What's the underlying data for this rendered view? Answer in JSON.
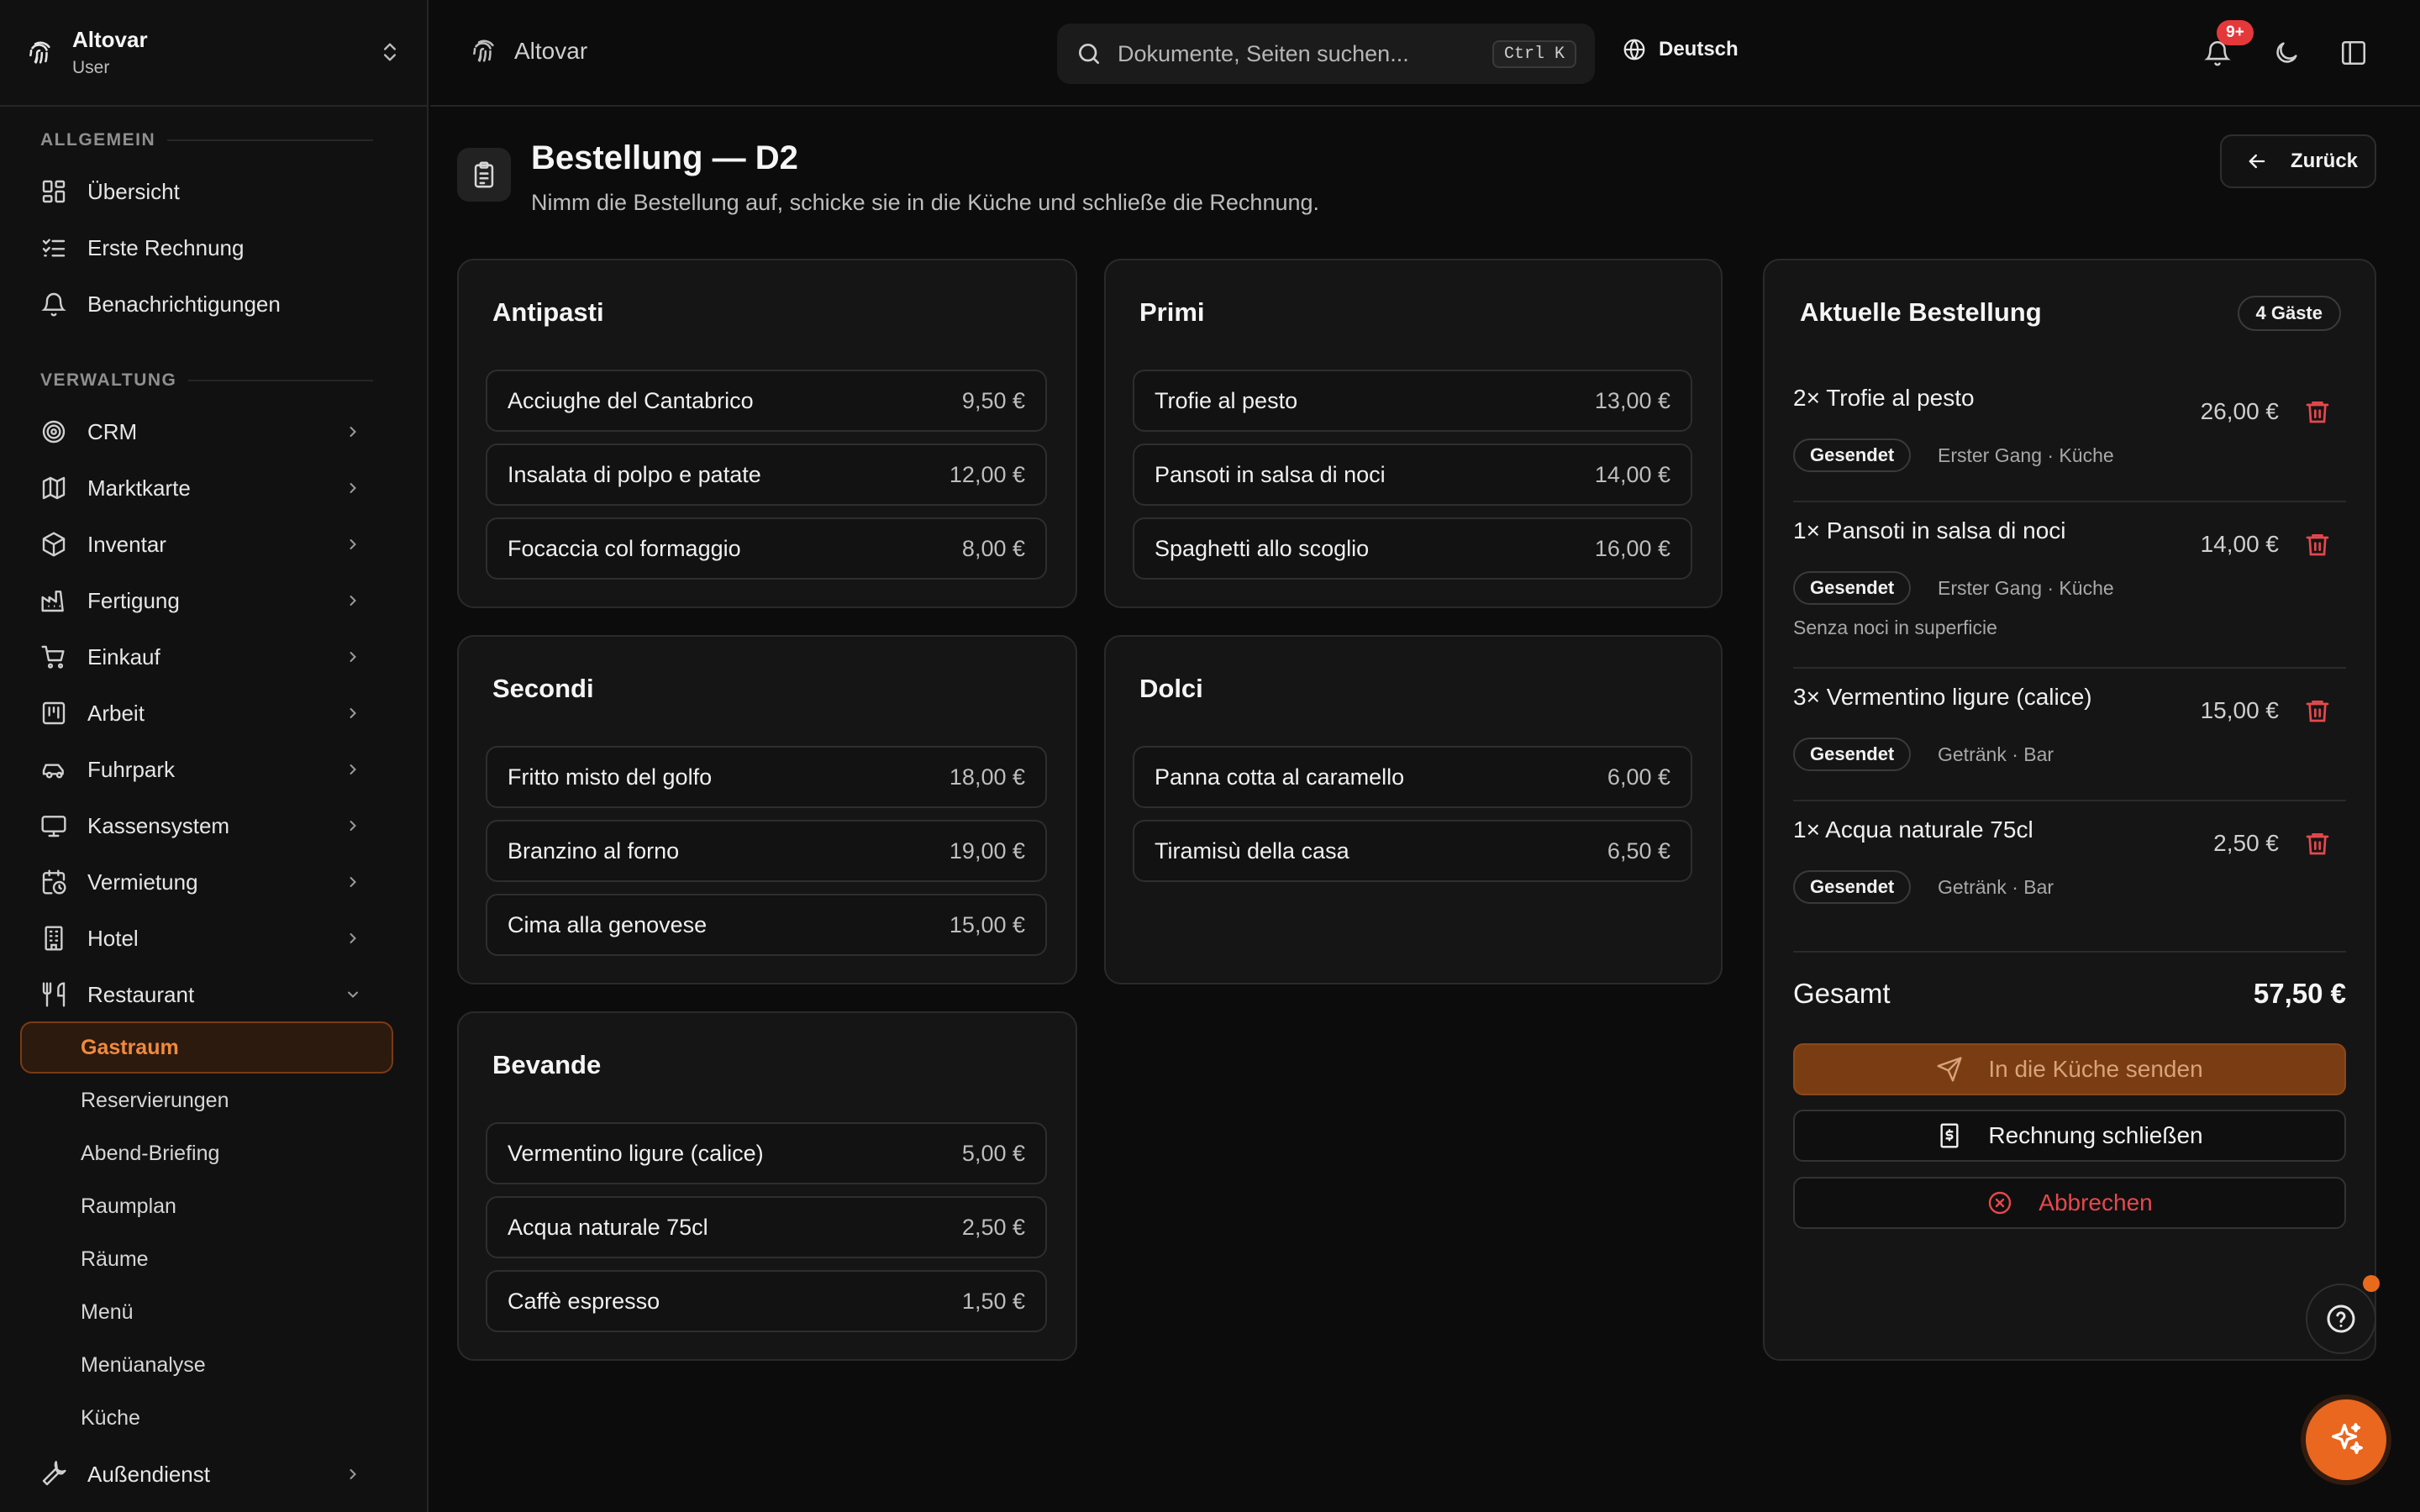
{
  "brand": {
    "name": "Altovar",
    "role": "User"
  },
  "topbar": {
    "breadcrumb": "Altovar",
    "search_placeholder": "Dokumente, Seiten suchen...",
    "search_shortcut": "Ctrl K",
    "language": "Deutsch",
    "notification_count": "9+"
  },
  "sidebar": {
    "section_general": "Allgemein",
    "general_items": [
      {
        "label": "Übersicht",
        "icon": "dashboard-icon"
      },
      {
        "label": "Erste Rechnung",
        "icon": "checklist-icon"
      },
      {
        "label": "Benachrichtigungen",
        "icon": "bell-icon"
      }
    ],
    "section_admin": "Verwaltung",
    "admin_items": [
      {
        "label": "CRM",
        "icon": "target-icon"
      },
      {
        "label": "Marktkarte",
        "icon": "map-icon"
      },
      {
        "label": "Inventar",
        "icon": "box-icon"
      },
      {
        "label": "Fertigung",
        "icon": "factory-icon"
      },
      {
        "label": "Einkauf",
        "icon": "cart-icon"
      },
      {
        "label": "Arbeit",
        "icon": "kanban-icon"
      },
      {
        "label": "Fuhrpark",
        "icon": "car-icon"
      },
      {
        "label": "Kassensystem",
        "icon": "monitor-icon"
      },
      {
        "label": "Vermietung",
        "icon": "calendar-clock-icon"
      },
      {
        "label": "Hotel",
        "icon": "building-icon"
      },
      {
        "label": "Restaurant",
        "icon": "utensils-icon"
      }
    ],
    "restaurant_sub": [
      "Gastraum",
      "Reservierungen",
      "Abend-Briefing",
      "Raumplan",
      "Räume",
      "Menü",
      "Menüanalyse",
      "Küche"
    ],
    "field_service": {
      "label": "Außendienst",
      "icon": "wrench-icon"
    }
  },
  "page": {
    "title": "Bestellung — D2",
    "subtitle": "Nimm die Bestellung auf, schicke sie in die Küche und schließe die Rechnung.",
    "back_label": "Zurück"
  },
  "menu": {
    "antipasti": {
      "title": "Antipasti",
      "items": [
        {
          "name": "Acciughe del Cantabrico",
          "price": "9,50 €"
        },
        {
          "name": "Insalata di polpo e patate",
          "price": "12,00 €"
        },
        {
          "name": "Focaccia col formaggio",
          "price": "8,00 €"
        }
      ]
    },
    "primi": {
      "title": "Primi",
      "items": [
        {
          "name": "Trofie al pesto",
          "price": "13,00 €"
        },
        {
          "name": "Pansoti in salsa di noci",
          "price": "14,00 €"
        },
        {
          "name": "Spaghetti allo scoglio",
          "price": "16,00 €"
        }
      ]
    },
    "secondi": {
      "title": "Secondi",
      "items": [
        {
          "name": "Fritto misto del golfo",
          "price": "18,00 €"
        },
        {
          "name": "Branzino al forno",
          "price": "19,00 €"
        },
        {
          "name": "Cima alla genovese",
          "price": "15,00 €"
        }
      ]
    },
    "dolci": {
      "title": "Dolci",
      "items": [
        {
          "name": "Panna cotta al caramello",
          "price": "6,00 €"
        },
        {
          "name": "Tiramisù della casa",
          "price": "6,50 €"
        }
      ]
    },
    "bevande": {
      "title": "Bevande",
      "items": [
        {
          "name": "Vermentino ligure (calice)",
          "price": "5,00 €"
        },
        {
          "name": "Acqua naturale 75cl",
          "price": "2,50 €"
        },
        {
          "name": "Caffè espresso",
          "price": "1,50 €"
        }
      ]
    }
  },
  "order": {
    "title": "Aktuelle Bestellung",
    "guests": "4 Gäste",
    "lines": [
      {
        "name": "2× Trofie al pesto",
        "price": "26,00 €",
        "status": "Gesendet",
        "meta": "Erster Gang · Küche",
        "note": ""
      },
      {
        "name": "1× Pansoti in salsa di noci",
        "price": "14,00 €",
        "status": "Gesendet",
        "meta": "Erster Gang · Küche",
        "note": "Senza noci in superficie"
      },
      {
        "name": "3× Vermentino ligure (calice)",
        "price": "15,00 €",
        "status": "Gesendet",
        "meta": "Getränk · Bar",
        "note": ""
      },
      {
        "name": "1× Acqua naturale 75cl",
        "price": "2,50 €",
        "status": "Gesendet",
        "meta": "Getränk · Bar",
        "note": ""
      }
    ],
    "total_label": "Gesamt",
    "total_value": "57,50 €",
    "send_label": "In die Küche senden",
    "close_label": "Rechnung schließen",
    "cancel_label": "Abbrechen"
  },
  "colors": {
    "accent": "#e9671f",
    "danger": "#e5484d",
    "background": "#0c0c0c"
  }
}
